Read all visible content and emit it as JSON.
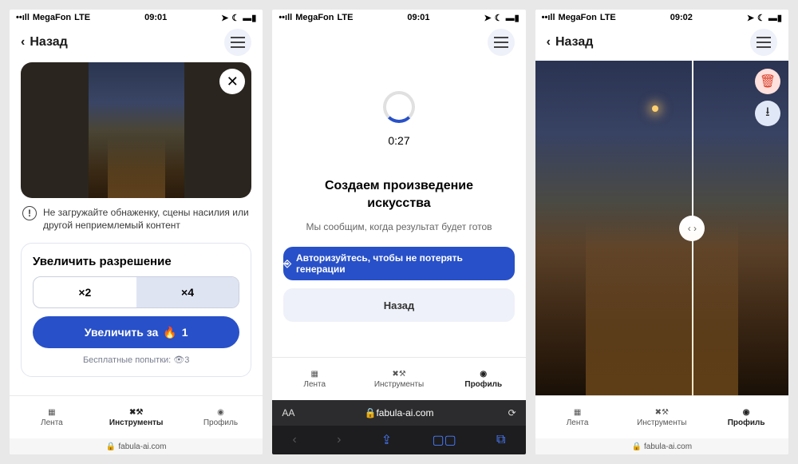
{
  "status": {
    "carrier": "MegaFon",
    "net": "LTE",
    "time1": "09:01",
    "time2": "09:01",
    "time3": "09:02"
  },
  "header": {
    "back": "Назад"
  },
  "screen1": {
    "warning": "Не загружайте обнаженку, сцены насилия или другой неприемлемый контент",
    "card_title": "Увеличить разрешение",
    "x2": "×2",
    "x4": "×4",
    "action": "Увеличить за",
    "cost": "1",
    "free_label": "Бесплатные попытки:",
    "free_count": "3"
  },
  "screen2": {
    "timer": "0:27",
    "title_l1": "Создаем произведение",
    "title_l2": "искусства",
    "subtitle": "Мы сообщим, когда результат будет готов",
    "auth": "Авторизуйтесь, чтобы не потерять генерации",
    "back": "Назад"
  },
  "tabs": {
    "feed": "Лента",
    "tools": "Инструменты",
    "profile": "Профиль"
  },
  "url": "fabula-ai.com",
  "safari_aa": "AA"
}
